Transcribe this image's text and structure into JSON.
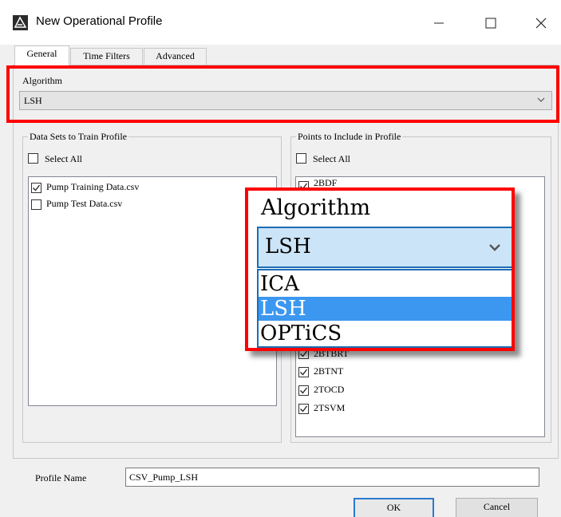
{
  "window": {
    "title": "New Operational Profile"
  },
  "tabs": [
    {
      "label": "General",
      "active": true
    },
    {
      "label": "Time Filters",
      "active": false
    },
    {
      "label": "Advanced",
      "active": false
    }
  ],
  "algorithm": {
    "label": "Algorithm",
    "selected": "LSH",
    "options": [
      "ICA",
      "LSH",
      "OPTiCS"
    ]
  },
  "data_sets": {
    "title": "Data Sets to Train Profile",
    "select_all": {
      "label": "Select All",
      "checked": false
    },
    "items": [
      {
        "label": "Pump Training Data.csv",
        "checked": true
      },
      {
        "label": "Pump Test Data.csv",
        "checked": false
      }
    ]
  },
  "points": {
    "title": "Points to Include in Profile",
    "select_all": {
      "label": "Select All",
      "checked": false
    },
    "items_visible": [
      {
        "label": "2BDF",
        "checked": true
      },
      {
        "label": "2BTBRT",
        "checked": true
      },
      {
        "label": "2BTNT",
        "checked": true
      },
      {
        "label": "2TOCD",
        "checked": true
      },
      {
        "label": "2TSVM",
        "checked": true
      }
    ]
  },
  "profile_name": {
    "label": "Profile Name",
    "value": "CSV_Pump_LSH"
  },
  "buttons": {
    "ok": "OK",
    "cancel": "Cancel"
  },
  "colors": {
    "highlight": "#ff0000",
    "selection": "#3c97f0",
    "focus_border": "#1c6cb5"
  }
}
